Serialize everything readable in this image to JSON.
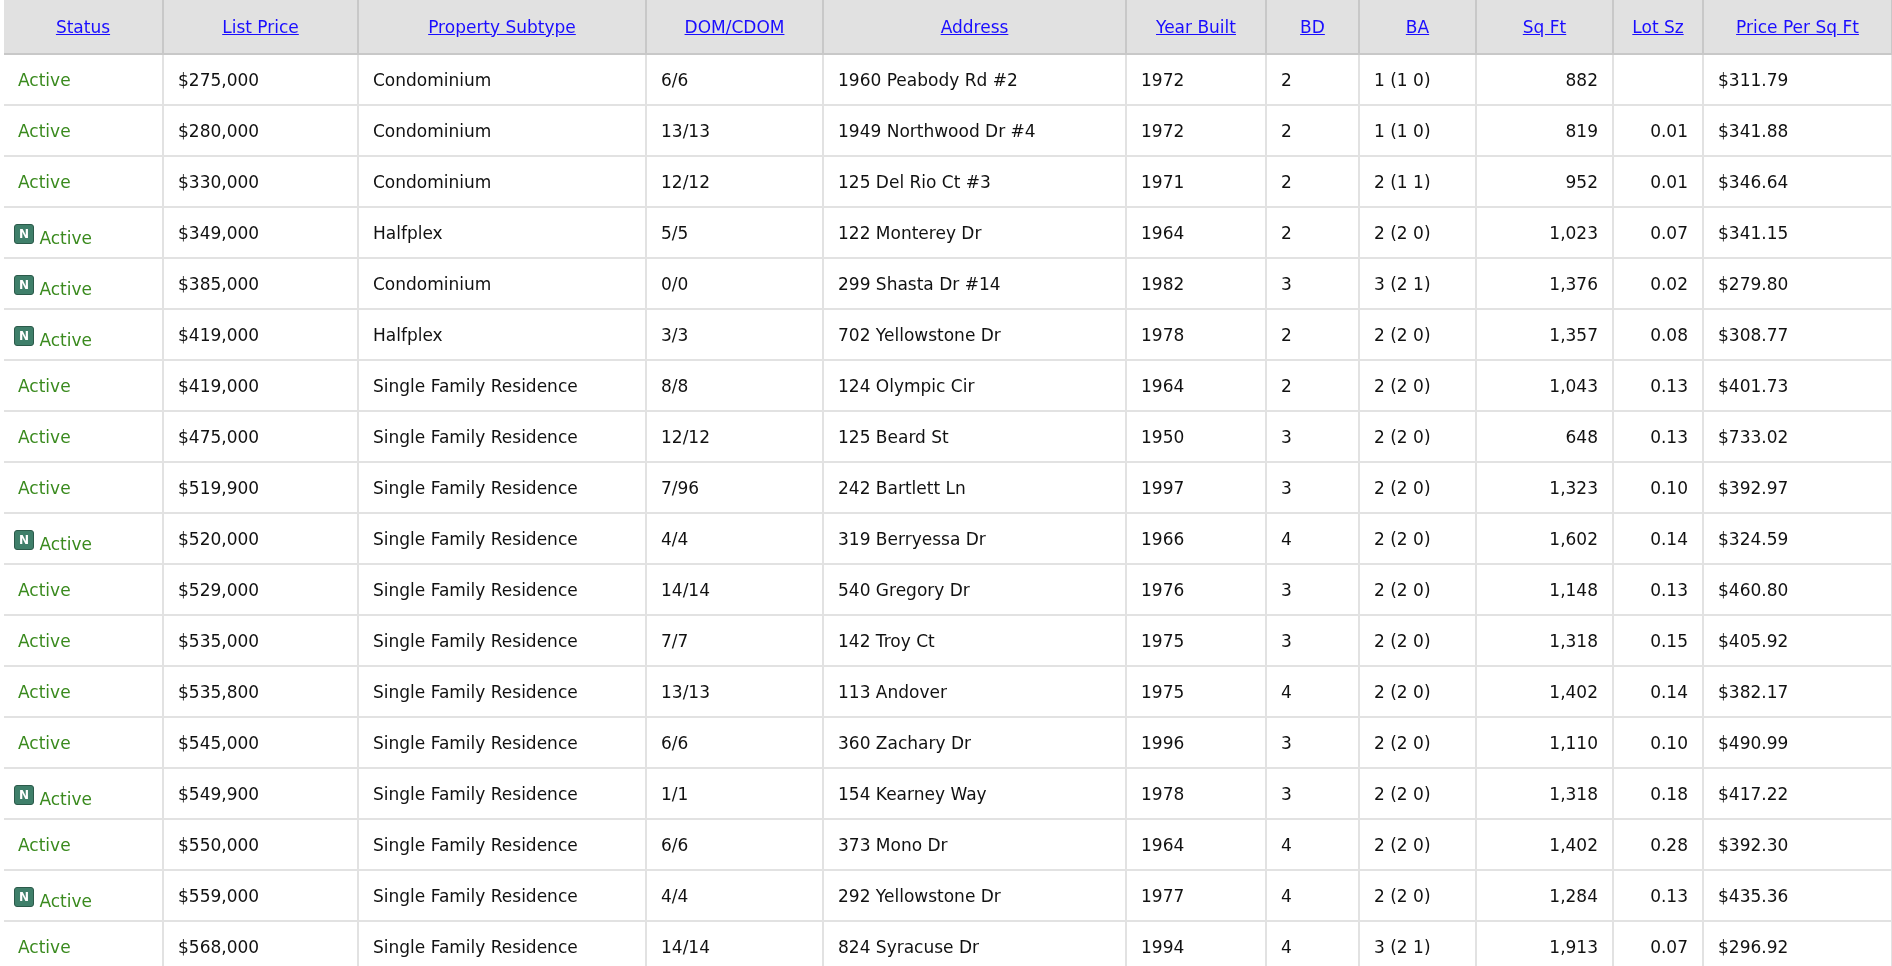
{
  "table": {
    "columns": [
      "Status",
      "List Price",
      "Property Subtype",
      "DOM/CDOM",
      "Address",
      "Year Built",
      "BD",
      "BA",
      "Sq Ft",
      "Lot Sz",
      "Price Per Sq Ft"
    ],
    "rows": [
      {
        "badge": null,
        "cells": [
          "Active",
          "$275,000",
          "Condominium",
          "6/6",
          "1960 Peabody Rd #2",
          "1972",
          "2",
          "1 (1 0)",
          "882",
          null,
          "$311.79"
        ]
      },
      {
        "badge": null,
        "cells": [
          "Active",
          "$280,000",
          "Condominium",
          "13/13",
          "1949 Northwood Dr #4",
          "1972",
          "2",
          "1 (1 0)",
          "819",
          "0.01",
          "$341.88"
        ]
      },
      {
        "badge": null,
        "cells": [
          "Active",
          "$330,000",
          "Condominium",
          "12/12",
          "125 Del Rio Ct #3",
          "1971",
          "2",
          "2 (1 1)",
          "952",
          "0.01",
          "$346.64"
        ]
      },
      {
        "badge": "N",
        "cells": [
          "Active",
          "$349,000",
          "Halfplex",
          "5/5",
          "122 Monterey Dr",
          "1964",
          "2",
          "2 (2 0)",
          "1,023",
          "0.07",
          "$341.15"
        ]
      },
      {
        "badge": "N",
        "cells": [
          "Active",
          "$385,000",
          "Condominium",
          "0/0",
          "299 Shasta Dr #14",
          "1982",
          "3",
          "3 (2 1)",
          "1,376",
          "0.02",
          "$279.80"
        ]
      },
      {
        "badge": "N",
        "cells": [
          "Active",
          "$419,000",
          "Halfplex",
          "3/3",
          "702 Yellowstone Dr",
          "1978",
          "2",
          "2 (2 0)",
          "1,357",
          "0.08",
          "$308.77"
        ]
      },
      {
        "badge": null,
        "cells": [
          "Active",
          "$419,000",
          "Single Family Residence",
          "8/8",
          "124 Olympic Cir",
          "1964",
          "2",
          "2 (2 0)",
          "1,043",
          "0.13",
          "$401.73"
        ]
      },
      {
        "badge": null,
        "cells": [
          "Active",
          "$475,000",
          "Single Family Residence",
          "12/12",
          "125 Beard St",
          "1950",
          "3",
          "2 (2 0)",
          "648",
          "0.13",
          "$733.02"
        ]
      },
      {
        "badge": null,
        "cells": [
          "Active",
          "$519,900",
          "Single Family Residence",
          "7/96",
          "242 Bartlett Ln",
          "1997",
          "3",
          "2 (2 0)",
          "1,323",
          "0.10",
          "$392.97"
        ]
      },
      {
        "badge": "N",
        "cells": [
          "Active",
          "$520,000",
          "Single Family Residence",
          "4/4",
          "319 Berryessa Dr",
          "1966",
          "4",
          "2 (2 0)",
          "1,602",
          "0.14",
          "$324.59"
        ]
      },
      {
        "badge": null,
        "cells": [
          "Active",
          "$529,000",
          "Single Family Residence",
          "14/14",
          "540 Gregory Dr",
          "1976",
          "3",
          "2 (2 0)",
          "1,148",
          "0.13",
          "$460.80"
        ]
      },
      {
        "badge": null,
        "cells": [
          "Active",
          "$535,000",
          "Single Family Residence",
          "7/7",
          "142 Troy Ct",
          "1975",
          "3",
          "2 (2 0)",
          "1,318",
          "0.15",
          "$405.92"
        ]
      },
      {
        "badge": null,
        "cells": [
          "Active",
          "$535,800",
          "Single Family Residence",
          "13/13",
          "113 Andover",
          "1975",
          "4",
          "2 (2 0)",
          "1,402",
          "0.14",
          "$382.17"
        ]
      },
      {
        "badge": null,
        "cells": [
          "Active",
          "$545,000",
          "Single Family Residence",
          "6/6",
          "360 Zachary Dr",
          "1996",
          "3",
          "2 (2 0)",
          "1,110",
          "0.10",
          "$490.99"
        ]
      },
      {
        "badge": "N",
        "cells": [
          "Active",
          "$549,900",
          "Single Family Residence",
          "1/1",
          "154 Kearney Way",
          "1978",
          "3",
          "2 (2 0)",
          "1,318",
          "0.18",
          "$417.22"
        ]
      },
      {
        "badge": null,
        "cells": [
          "Active",
          "$550,000",
          "Single Family Residence",
          "6/6",
          "373 Mono Dr",
          "1964",
          "4",
          "2 (2 0)",
          "1,402",
          "0.28",
          "$392.30"
        ]
      },
      {
        "badge": "N",
        "cells": [
          "Active",
          "$559,000",
          "Single Family Residence",
          "4/4",
          "292 Yellowstone Dr",
          "1977",
          "4",
          "2 (2 0)",
          "1,284",
          "0.13",
          "$435.36"
        ]
      },
      {
        "badge": null,
        "cells": [
          "Active",
          "$568,000",
          "Single Family Residence",
          "14/14",
          "824 Syracuse Dr",
          "1994",
          "4",
          "3 (2 1)",
          "1,913",
          "0.07",
          "$296.92"
        ]
      }
    ]
  }
}
